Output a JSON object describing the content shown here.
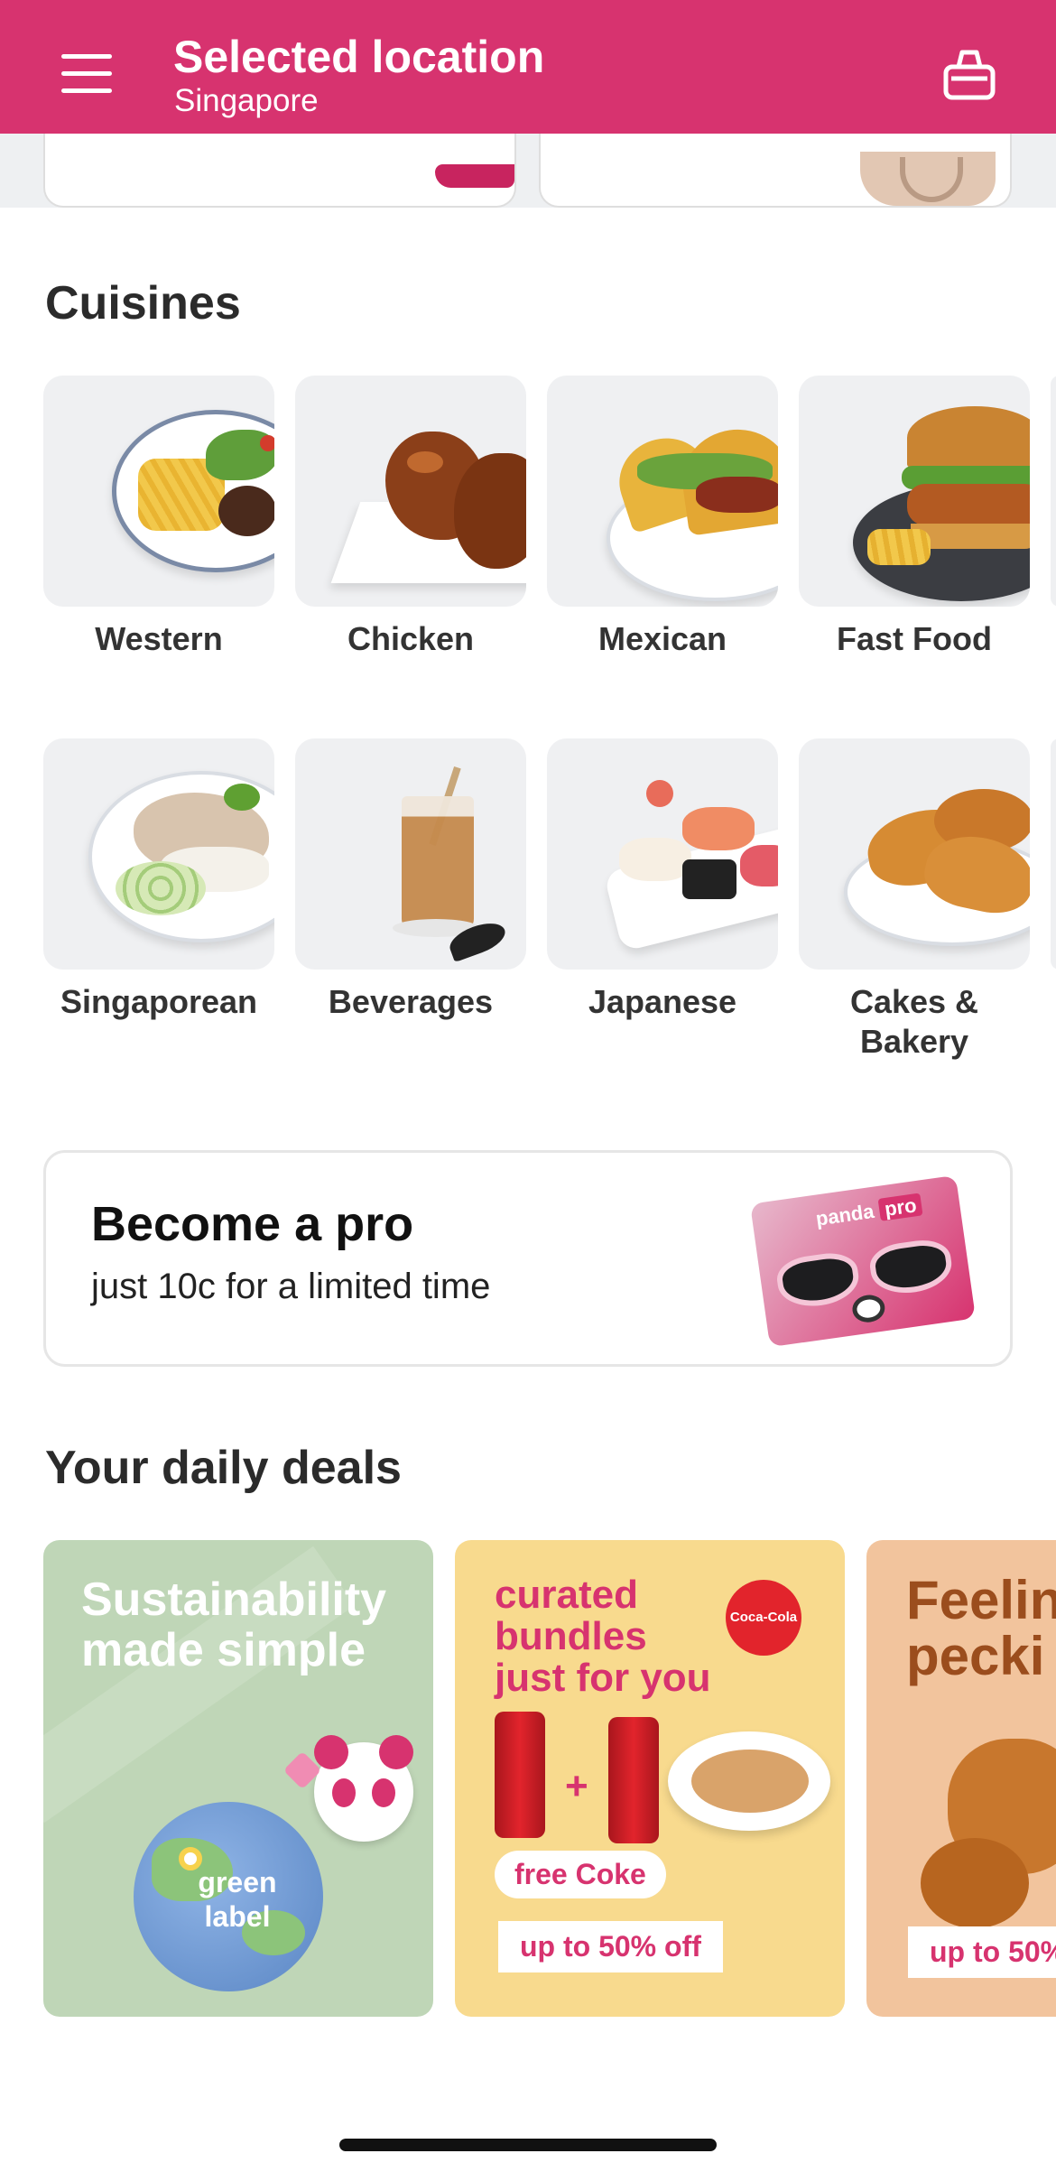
{
  "header": {
    "title": "Selected location",
    "location": "Singapore",
    "menu_icon": "hamburger-menu-icon",
    "cart_icon": "shopping-basket-icon",
    "brand_color": "#d7336f"
  },
  "cuisines": {
    "title": "Cuisines",
    "items": [
      {
        "label": "Western",
        "icon": "western-dish-image"
      },
      {
        "label": "Chicken",
        "icon": "chicken-dish-image"
      },
      {
        "label": "Mexican",
        "icon": "mexican-dish-image"
      },
      {
        "label": "Fast Food",
        "icon": "fast-food-image"
      },
      {
        "label": "Singaporean",
        "icon": "singaporean-dish-image"
      },
      {
        "label": "Beverages",
        "icon": "beverage-image"
      },
      {
        "label": "Japanese",
        "icon": "japanese-dish-image"
      },
      {
        "label": "Cakes &\nBakery",
        "icon": "bakery-image"
      }
    ]
  },
  "pro_banner": {
    "title": "Become a pro",
    "subtitle": "just 10c for a limited time",
    "card_text": "panda",
    "card_badge": "pro"
  },
  "deals": {
    "title": "Your daily deals",
    "cards": [
      {
        "headline": "Sustainability made simple",
        "badge": "green label"
      },
      {
        "headline": "curated bundles just for you",
        "brand": "Coca-Cola",
        "pill": "free Coke",
        "offer": "up to 50% off"
      },
      {
        "headline": "Feelin pecki",
        "offer": "up to 50%"
      }
    ]
  }
}
